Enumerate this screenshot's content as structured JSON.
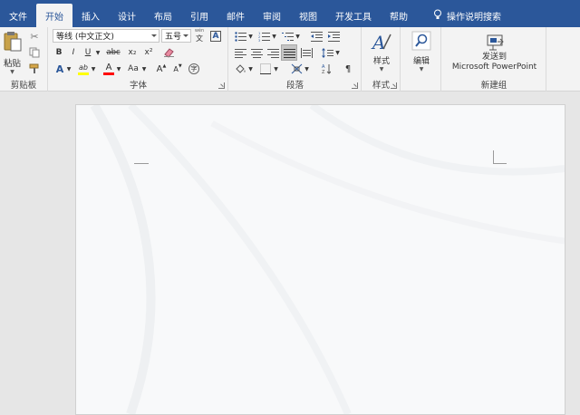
{
  "tabs": [
    {
      "label": "文件",
      "active": false
    },
    {
      "label": "开始",
      "active": true
    },
    {
      "label": "插入",
      "active": false
    },
    {
      "label": "设计",
      "active": false
    },
    {
      "label": "布局",
      "active": false
    },
    {
      "label": "引用",
      "active": false
    },
    {
      "label": "邮件",
      "active": false
    },
    {
      "label": "审阅",
      "active": false
    },
    {
      "label": "视图",
      "active": false
    },
    {
      "label": "开发工具",
      "active": false
    },
    {
      "label": "帮助",
      "active": false
    }
  ],
  "tell_me": "操作说明搜索",
  "clipboard": {
    "label": "剪贴板",
    "paste": "粘贴"
  },
  "font": {
    "label": "字体",
    "name": "等线 (中文正文)",
    "size": "五号",
    "wen": "文",
    "bold": "B",
    "italic": "I",
    "underline": "U",
    "strike": "abc",
    "subscript": "x₂",
    "superscript": "x²",
    "text_effects": "A",
    "highlight": "ab",
    "font_color": "A",
    "change_case": "Aa",
    "grow": "A",
    "shrink": "A",
    "phonetic": "wén",
    "enclose": "字"
  },
  "paragraph": {
    "label": "段落"
  },
  "styles": {
    "label": "样式",
    "button": "样式"
  },
  "editing": {
    "button": "编辑"
  },
  "new_group": {
    "label": "新建组",
    "line1": "发送到",
    "line2": "Microsoft PowerPoint"
  },
  "colors": {
    "accent": "#2b579a",
    "highlight": "#ffff00",
    "font_red": "#ff0000"
  }
}
